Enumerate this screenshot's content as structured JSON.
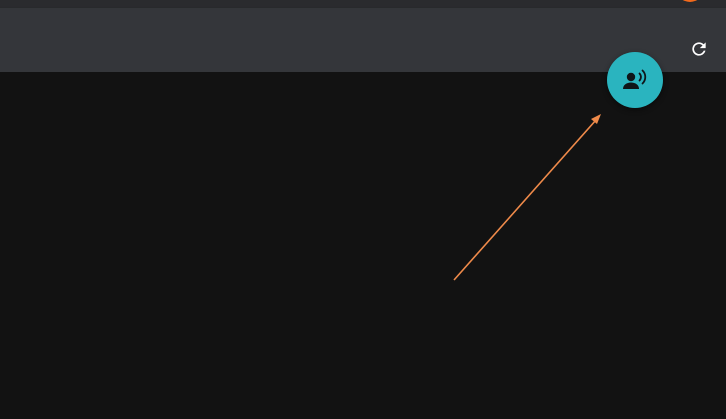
{
  "header": {
    "notification_indicator_color": "#f26a1c",
    "refresh_icon": "refresh-icon"
  },
  "fab": {
    "icon": "voice-speaking-person-icon",
    "color": "#2ab4bf"
  },
  "annotation": {
    "arrow_color": "#ef8a4a"
  },
  "theme": {
    "background": "#121212",
    "toolbar": "#34363a"
  }
}
